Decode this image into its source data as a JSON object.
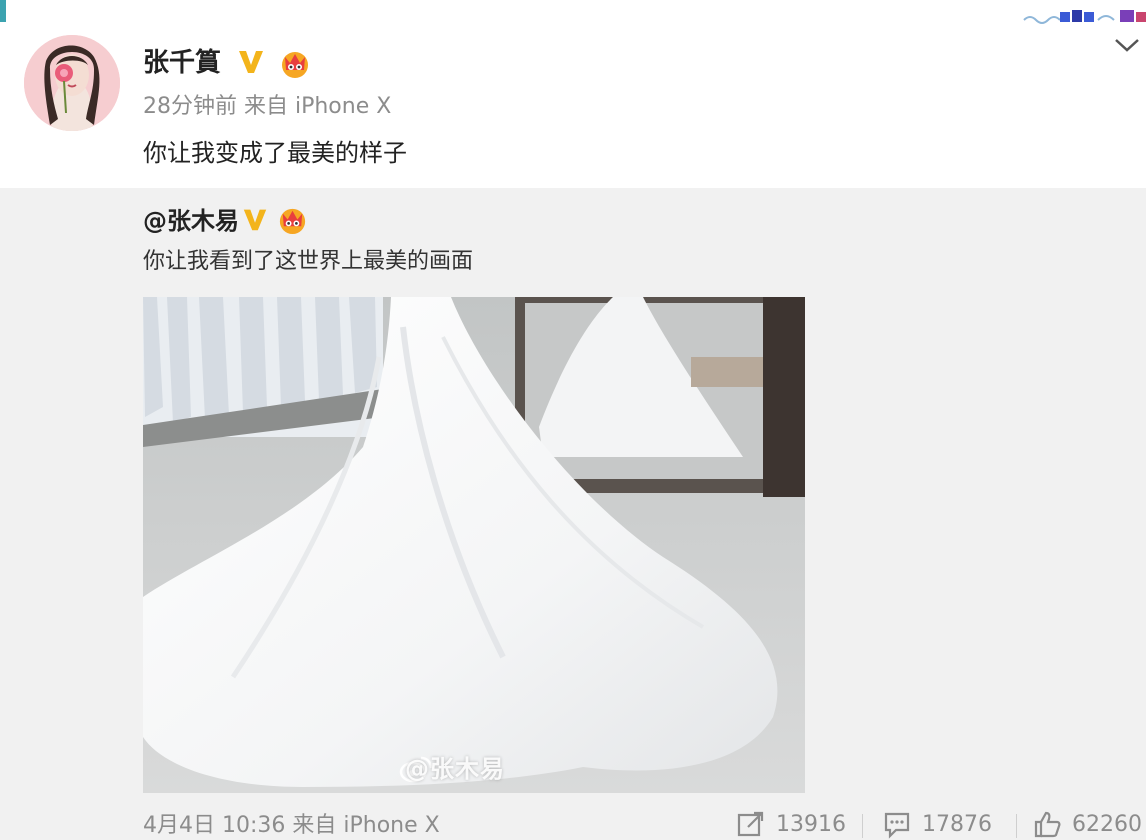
{
  "post": {
    "username": "张千篔",
    "meta": "28分钟前 来自 iPhone X",
    "text": "你让我变成了最美的样子"
  },
  "repost": {
    "author": "@张木易",
    "text": "你让我看到了这世界上最美的画面",
    "photo_watermark": "@张木易",
    "meta": "4月4日 10:36 来自 iPhone X",
    "actions": {
      "forward_count": "13916",
      "comment_count": "17876",
      "like_count": "62260"
    }
  },
  "colors": {
    "username": "#222222",
    "meta": "#8c8c8c",
    "vip_badge": "#f3b41b",
    "card_bg": "#ffffff",
    "repost_bg": "#f1f1f1"
  },
  "icons": {
    "verified": "verified-v-icon",
    "member": "member-crown-icon",
    "menu": "chevron-down-icon",
    "forward": "forward-icon",
    "comment": "comment-icon",
    "like": "like-icon"
  }
}
